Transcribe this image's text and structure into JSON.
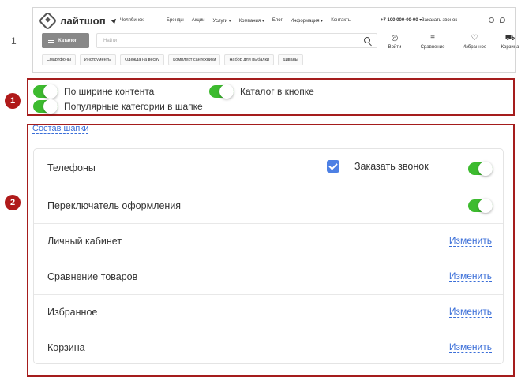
{
  "preview": {
    "row_number": "1",
    "logo_text": "лайтшоп",
    "city": "Челябинск",
    "nav": [
      "Бренды",
      "Акции",
      "Услуги ▾",
      "Компания ▾",
      "Блог",
      "Информация ▾",
      "Контакты"
    ],
    "phone": "+7 100 000-00-00 ▾",
    "callback": "Заказать звонок",
    "catalog_button": "Каталог",
    "search_placeholder": "Найти",
    "header_icons": [
      {
        "label": "Войти",
        "icon": "user-icon"
      },
      {
        "label": "Сравнение",
        "icon": "compare-icon"
      },
      {
        "label": "Избранное",
        "icon": "heart-icon"
      },
      {
        "label": "Корзина",
        "icon": "cart-icon"
      }
    ],
    "categories": [
      "Смартфоны",
      "Инструменты",
      "Одежда на весну",
      "Комплект сантехники",
      "Набор для рыбалки",
      "Диваны"
    ]
  },
  "badges": [
    "1",
    "2"
  ],
  "options": {
    "content_width": "По ширине контента",
    "catalog_in_button": "Каталог в кнопке",
    "popular_categories": "Популярные категории в шапке"
  },
  "header_composition": {
    "link": "Состав шапки",
    "rows": [
      {
        "label": "Телефоны",
        "extra_label": "Заказать звонок"
      },
      {
        "label": "Переключатель оформления"
      },
      {
        "label": "Личный кабинет",
        "action": "Изменить"
      },
      {
        "label": "Сравнение товаров",
        "action": "Изменить"
      },
      {
        "label": "Избранное",
        "action": "Изменить"
      },
      {
        "label": "Корзина",
        "action": "Изменить"
      }
    ]
  },
  "colors": {
    "accent_green": "#3dbb2f",
    "link_blue": "#3a6ed8",
    "marker_red": "#a51d1d"
  }
}
